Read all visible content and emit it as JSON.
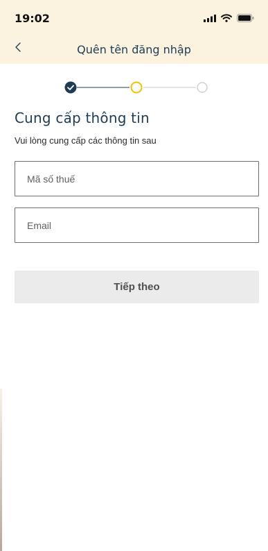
{
  "status_bar": {
    "time": "19:02",
    "icons": [
      "signal-icon",
      "wifi-icon",
      "battery-icon"
    ]
  },
  "nav": {
    "title": "Quên tên đăng nhập",
    "back_icon": "chevron-left-icon"
  },
  "stepper": {
    "current_step": 2,
    "total_steps": 3,
    "colors": {
      "completed": "#1d3c56",
      "current": "#f2c200",
      "pending": "#c8c8c8"
    }
  },
  "form": {
    "heading": "Cung cấp thông tin",
    "subtext": "Vui lòng cung cấp các thông tin sau",
    "tax_code": {
      "value": "",
      "placeholder": "Mã số thuế"
    },
    "email": {
      "value": "",
      "placeholder": "Email"
    },
    "next_label": "Tiếp theo"
  },
  "colors": {
    "header_bg": "#fbf3df",
    "primary_text": "#1d3c56",
    "button_disabled_bg": "#ebebeb"
  }
}
